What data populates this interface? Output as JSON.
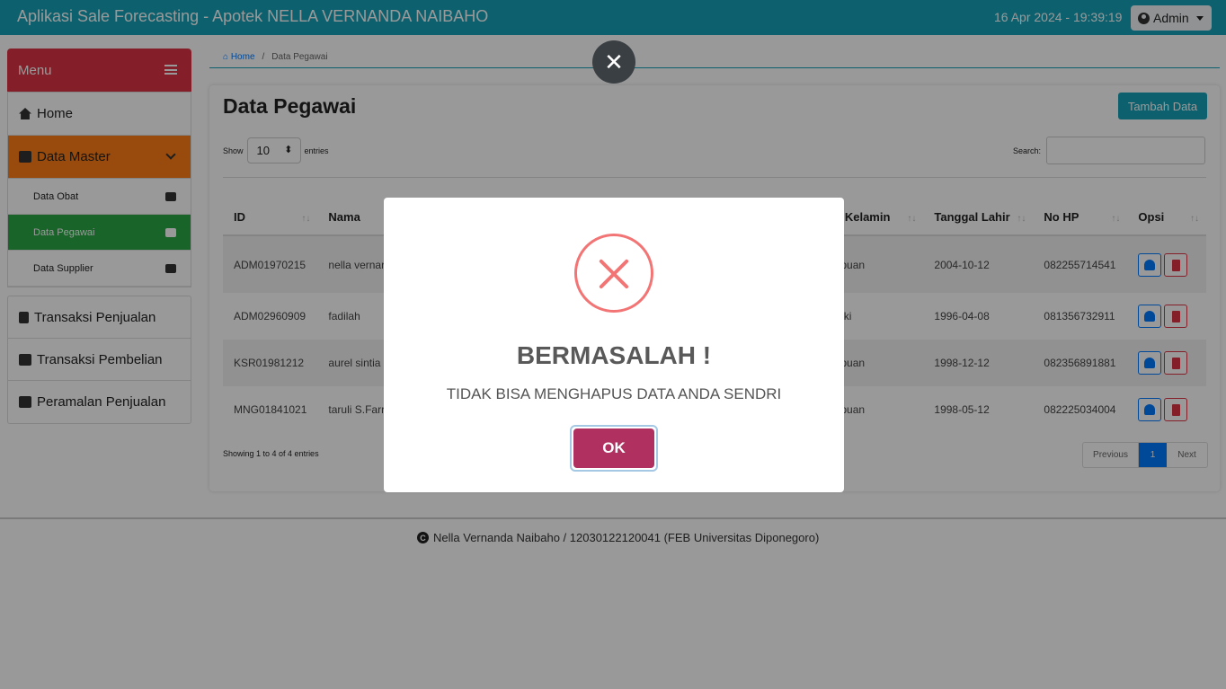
{
  "navbar": {
    "title": "Aplikasi Sale Forecasting - Apotek NELLA VERNANDA NAIBAHO",
    "datetime": "16 Apr 2024 -  19:39:19",
    "user_label": "Admin"
  },
  "sidebar": {
    "menu_label": "Menu",
    "home": "Home",
    "data_master": "Data Master",
    "sub_items": [
      {
        "label": "Data Obat"
      },
      {
        "label": "Data Pegawai"
      },
      {
        "label": "Data Supplier"
      }
    ],
    "items2": [
      {
        "label": "Transaksi Penjualan"
      },
      {
        "label": "Transaksi Pembelian"
      },
      {
        "label": "Peramalan Penjualan"
      }
    ]
  },
  "breadcrumb": {
    "home": "Home",
    "current": "Data Pegawai"
  },
  "card": {
    "title": "Data Pegawai",
    "add_button": "Tambah Data",
    "show_label": "Show",
    "entries_label": "entries",
    "entries_value": "10",
    "search_label": "Search:",
    "showing_text": "Showing 1 to 4 of 4 entries",
    "pager": {
      "prev": "Previous",
      "current": "1",
      "next": "Next"
    }
  },
  "table": {
    "headers": [
      "ID",
      "Nama",
      "is Kelamin",
      "Tanggal Lahir",
      "No HP",
      "Opsi"
    ],
    "rows": [
      {
        "id": "ADM01970215",
        "nama": "nella vernar naibaho",
        "jk": "mpuan",
        "tgl": "2004-10-12",
        "hp": "082255714541"
      },
      {
        "id": "ADM02960909",
        "nama": "fadilah",
        "jk": "-laki",
        "tgl": "1996-04-08",
        "hp": "081356732911"
      },
      {
        "id": "KSR01981212",
        "nama": "aurel sintia",
        "jk": "mpuan",
        "tgl": "1998-12-12",
        "hp": "082356891881"
      },
      {
        "id": "MNG01841021",
        "nama": "taruli S.Farr",
        "jk": "mpuan",
        "tgl": "1998-05-12",
        "hp": "082225034004"
      }
    ]
  },
  "footer": {
    "text": "Nella Vernanda Naibaho / 12030122120041 (FEB Universitas Diponegoro)"
  },
  "modal": {
    "title": "BERMASALAH !",
    "message": "TIDAK BISA MENGHAPUS DATA ANDA SENDRI",
    "ok_label": "OK",
    "close_glyph": "✕"
  },
  "colors": {
    "navbar": "#17a2b8",
    "menu_header": "#dc3545",
    "data_master": "#fd7e14",
    "active_item": "#28a745",
    "ok_button": "#b03060",
    "error_icon": "#f27474"
  }
}
